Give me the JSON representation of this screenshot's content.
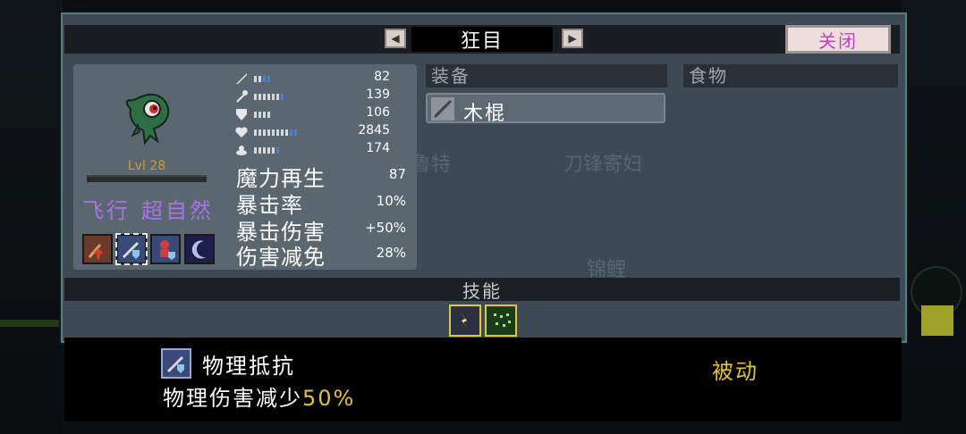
{
  "window": {
    "title": "狂目",
    "prev_label": "◀",
    "next_label": "▶",
    "close_label": "关闭"
  },
  "character": {
    "level": "Lvl 28",
    "traits": [
      "飞行",
      "超自然"
    ],
    "stats": [
      {
        "icon": "sword-icon",
        "value": "82",
        "pips": 2,
        "blue": 2
      },
      {
        "icon": "staff-icon",
        "value": "139",
        "pips": 6,
        "blue": 1
      },
      {
        "icon": "shield-icon",
        "value": "106",
        "pips": 4,
        "blue": 0
      },
      {
        "icon": "heart-icon",
        "value": "2845",
        "pips": 8,
        "blue": 2
      },
      {
        "icon": "speed-icon",
        "value": "174",
        "pips": 5,
        "blue": 1
      }
    ],
    "advanced": [
      {
        "label": "魔力再生",
        "value": "87"
      },
      {
        "label": "暴击率",
        "value": "10%"
      },
      {
        "label": "暴击伤害",
        "value": "+50%"
      },
      {
        "label": "伤害减免",
        "value": "28%"
      }
    ],
    "skill_icons": [
      "attack-up-icon",
      "physical-resist-icon",
      "summon-icon",
      "moon-icon"
    ]
  },
  "equipment": {
    "header": "装备",
    "item": "木棍",
    "food_header": "食物"
  },
  "skills": {
    "header": "技能"
  },
  "tooltip": {
    "name": "物理抵抗",
    "desc_prefix": "物理伤害减少",
    "desc_value": "50%",
    "type": "被动"
  },
  "colors": {
    "accent_gold": "#e3c13a",
    "trait_purple": "#a972e6",
    "close_pink": "#c93fc1",
    "level_orange": "#d19a37"
  }
}
